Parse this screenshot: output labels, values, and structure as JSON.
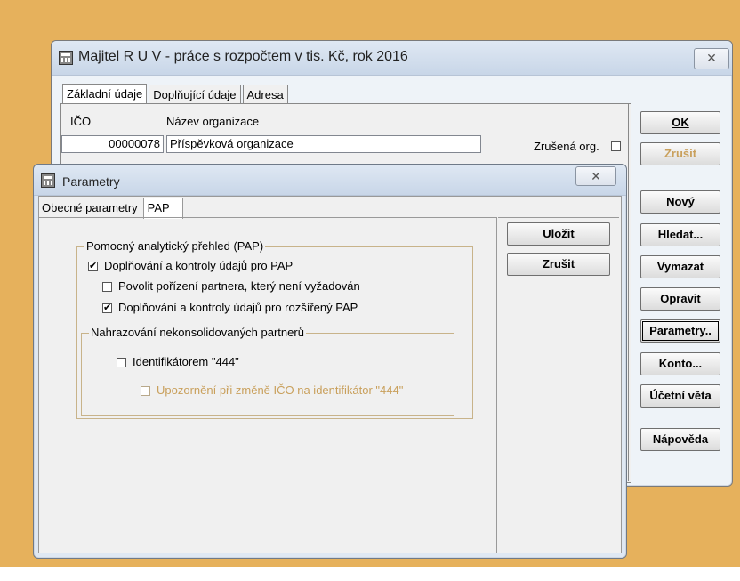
{
  "back_window": {
    "title": "Majitel R U V - práce s rozpočtem v tis. Kč,  rok 2016",
    "close_glyph": "✕",
    "tabs": [
      "Základní údaje",
      "Doplňující údaje",
      "Adresa"
    ],
    "ico_label": "IČO",
    "name_label": "Název organizace",
    "ico_value": "00000078",
    "name_value": "Příspěvková organizace",
    "zrusena_label": "Zrušená org.",
    "buttons": {
      "ok": "OK",
      "zrusit": "Zrušit",
      "novy": "Nový",
      "hledat": "Hledat...",
      "vymazat": "Vymazat",
      "opravit": "Opravit",
      "parametry": "Parametry..",
      "konto": "Konto...",
      "ucetni_veta": "Účetní věta",
      "napoveda": "Nápověda"
    }
  },
  "dialog": {
    "title": "Parametry",
    "close_glyph": "✕",
    "tabs": [
      "Obecné parametry",
      "PAP"
    ],
    "group_pap_title": "Pomocný analytický přehled (PAP)",
    "check1_label": "Doplňování a kontroly údajů pro PAP",
    "check2_label": "Povolit pořízení partnera, který není vyžadován",
    "check3_label": "Doplňování a kontroly údajů pro rozšířený PAP",
    "group_nahr_title": "Nahrazování  nekonsolidovaných partnerů",
    "check4_label": "Identifikátorem \"444\"",
    "check5_label": "Upozornění při změně IČO na identifikátor \"444\"",
    "check_mark": "✔",
    "buttons": {
      "ulozit": "Uložit",
      "zrusit": "Zrušit"
    }
  }
}
